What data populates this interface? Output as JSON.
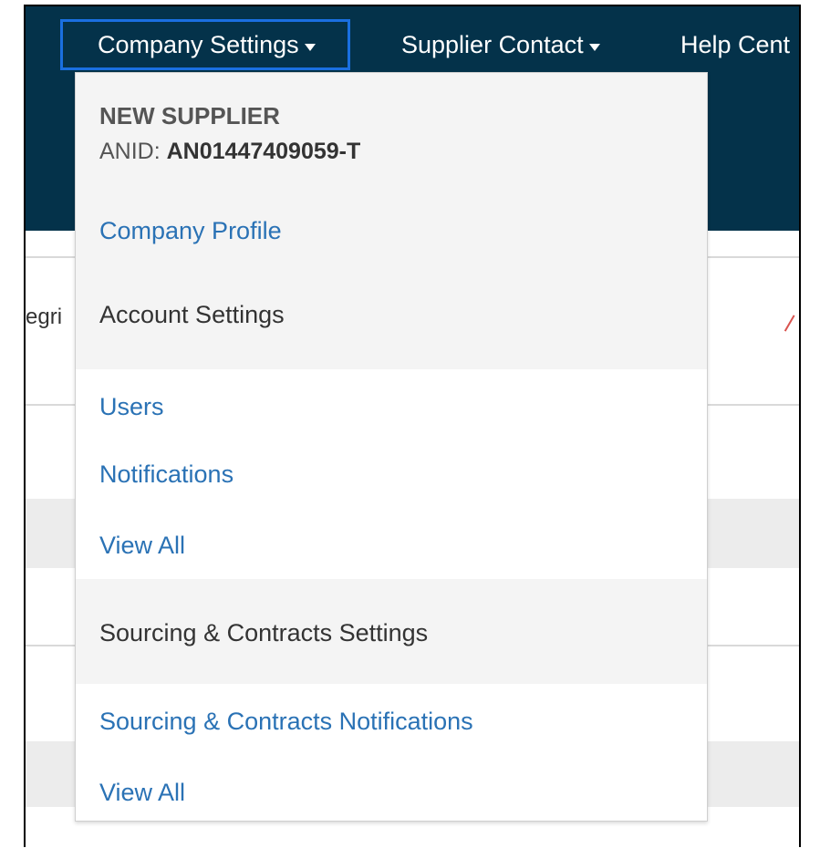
{
  "nav": {
    "company_settings": "Company Settings",
    "supplier_contact": "Supplier Contact",
    "help_center": "Help Cent"
  },
  "background": {
    "partial_text": "egri"
  },
  "dropdown": {
    "company_name": "NEW SUPPLIER",
    "anid_label": "ANID: ",
    "anid_value": "AN01447409059-T",
    "company_profile": "Company Profile",
    "account_settings": "Account Settings",
    "users": "Users",
    "notifications": "Notifications",
    "view_all_1": "View All",
    "sourcing_settings": "Sourcing & Contracts Settings",
    "sourcing_notifications": "Sourcing & Contracts Notifications",
    "view_all_2": "View All"
  },
  "colors": {
    "header_bg": "#04324a",
    "focus_border": "#1a6fe0",
    "link": "#2a72b5"
  }
}
